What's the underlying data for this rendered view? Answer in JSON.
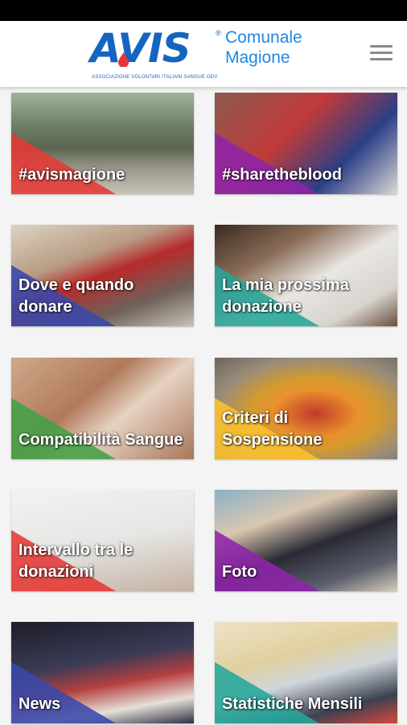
{
  "header": {
    "logo_text": "AVIS",
    "registered_mark": "®",
    "logo_tagline": "ASSOCIAZIONE VOLONTARI ITALIANI SANGUE ODV",
    "org_line1": "Comunale",
    "org_line2": "Magione",
    "brand_color": "#1565c0",
    "menu_icon": "hamburger-menu-icon"
  },
  "tiles": [
    {
      "label": "#avismagione",
      "accent": "#e53935"
    },
    {
      "label": "#sharetheblood",
      "accent": "#8e24aa"
    },
    {
      "label": "Dove e quando donare",
      "accent": "#3949ab"
    },
    {
      "label": "La mia prossima donazione",
      "accent": "#26a69a"
    },
    {
      "label": "Compatibilità Sangue",
      "accent": "#43a047"
    },
    {
      "label": "Criteri di Sospensione",
      "accent": "#fbc02d"
    },
    {
      "label": "Intervallo tra le donazioni",
      "accent": "#e53935"
    },
    {
      "label": "Foto",
      "accent": "#8e24aa"
    },
    {
      "label": "News",
      "accent": "#3949ab"
    },
    {
      "label": "Statistiche Mensili",
      "accent": "#26a69a"
    }
  ]
}
